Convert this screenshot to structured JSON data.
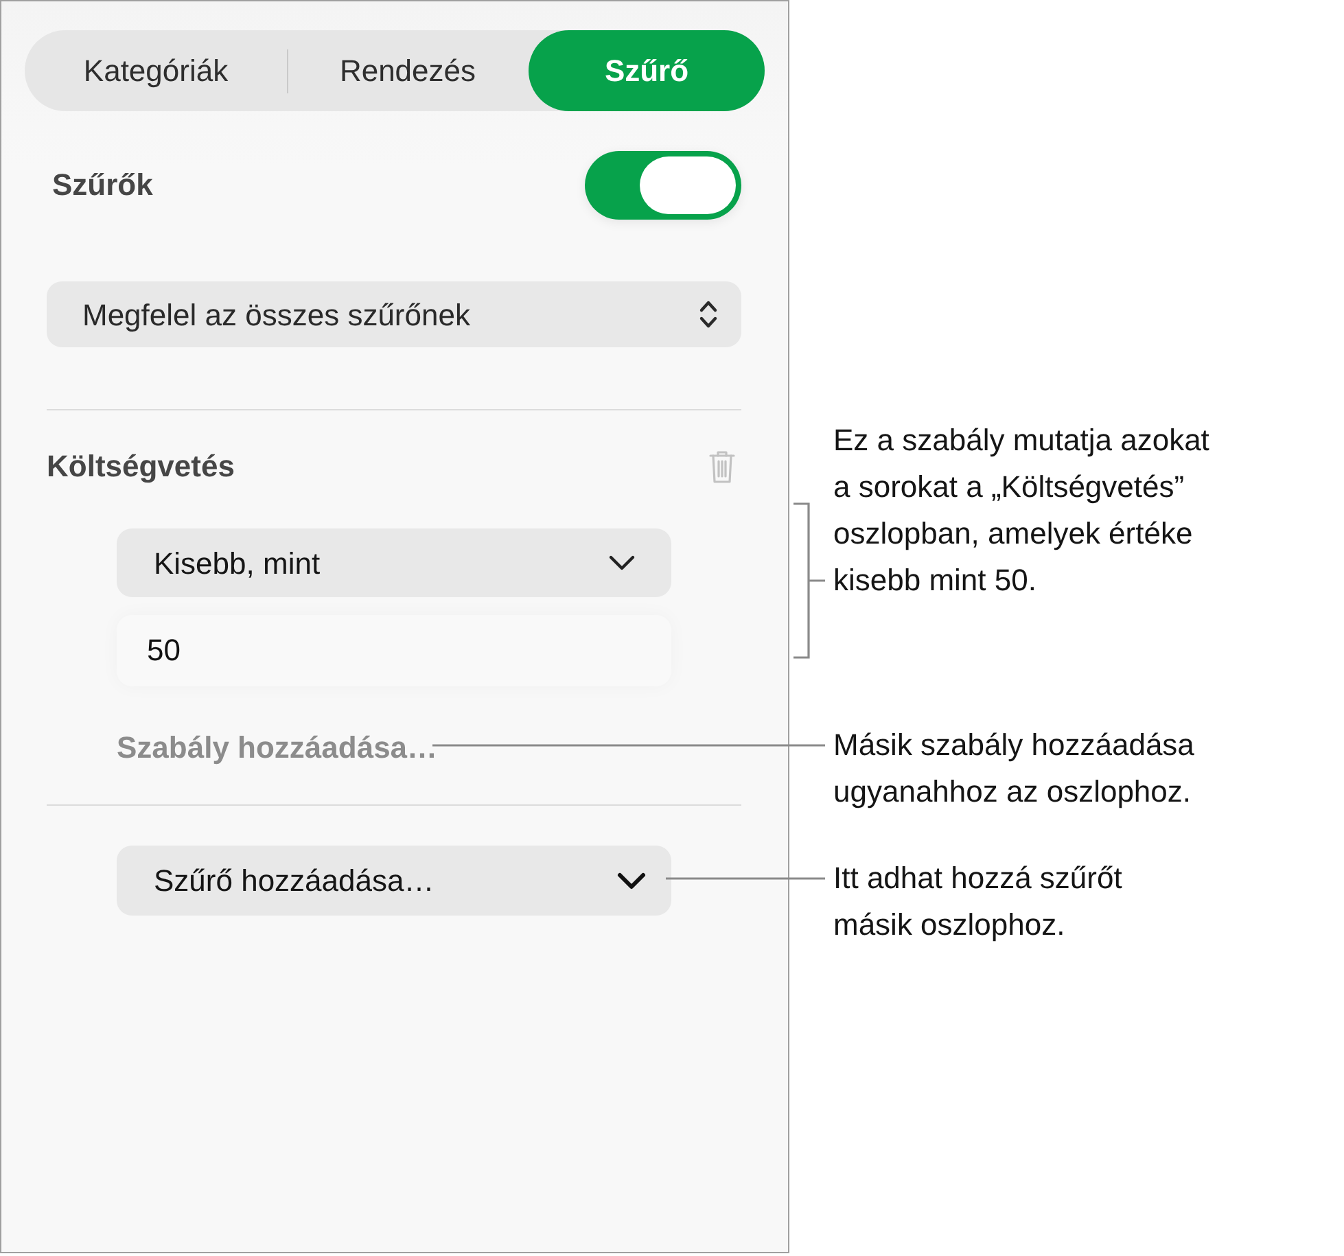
{
  "tabs": [
    {
      "label": "Kategóriák",
      "selected": false
    },
    {
      "label": "Rendezés",
      "selected": false
    },
    {
      "label": "Szűrő",
      "selected": true
    }
  ],
  "filters_toggle": {
    "label": "Szűrők",
    "on": true
  },
  "match_select": {
    "value": "Megfelel az összes szűrőnek"
  },
  "rules": [
    {
      "column": "Költségvetés",
      "condition": "Kisebb, mint",
      "value": "50",
      "add_rule_link": "Szabály hozzáadása…"
    }
  ],
  "add_filter": {
    "label": "Szűrő hozzáadása…"
  },
  "callouts": [
    {
      "kind": "bracket",
      "text": "Ez a szabály mutatja azokat\na sorokat a „Költségvetés”\noszlopban, amelyek értéke\nkisebb mint 50."
    },
    {
      "kind": "leader",
      "text": "Másik szabály hozzáadása\nugyanahhoz az oszlophoz."
    },
    {
      "kind": "leader",
      "text": "Itt adhat hozzá szűrőt\nmásik oszlophoz."
    }
  ]
}
